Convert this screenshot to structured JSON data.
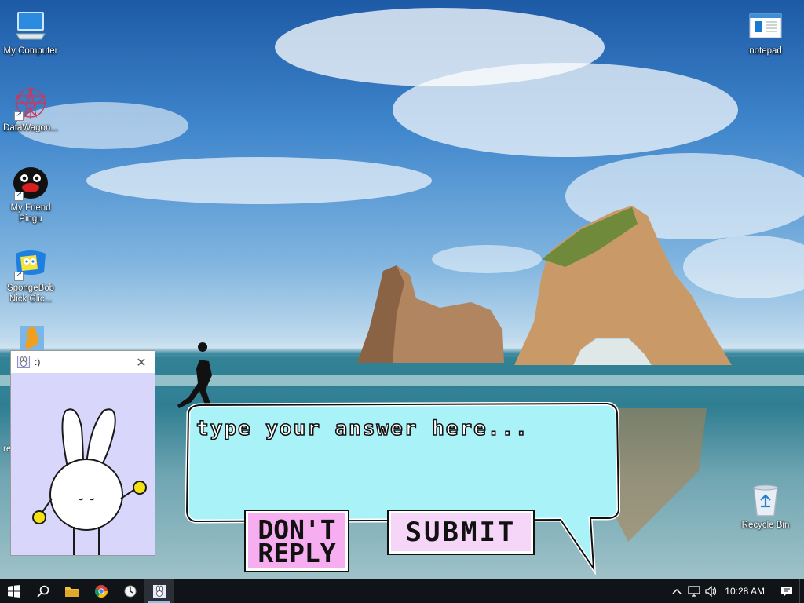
{
  "desktop": {
    "icons": [
      {
        "label": "My Computer"
      },
      {
        "label": "DataWagon..."
      },
      {
        "label": "My Friend Pingu"
      },
      {
        "label": "SpongeBob Nick Clic..."
      },
      {
        "label": "re"
      },
      {
        "label": "notepad"
      },
      {
        "label": "Recycle Bin"
      }
    ]
  },
  "mini_window": {
    "title": ":)",
    "close_glyph": "✕"
  },
  "dialog": {
    "answer_placeholder": "type your answer here...",
    "answer_value": "",
    "dont_reply_label": "DON'T REPLY",
    "submit_label": "SUBMIT",
    "bubble_color": "#a9f3f8",
    "dont_reply_color": "#f6aef0",
    "submit_color": "#f6d6f8"
  },
  "taskbar": {
    "items": [
      "windows-start",
      "search",
      "file-explorer",
      "chrome",
      "clock-app",
      "bunny-app"
    ],
    "clock": "10:28 AM",
    "tray_icons": [
      "chevron-up-icon",
      "network-icon",
      "volume-icon",
      "notification-icon"
    ]
  }
}
